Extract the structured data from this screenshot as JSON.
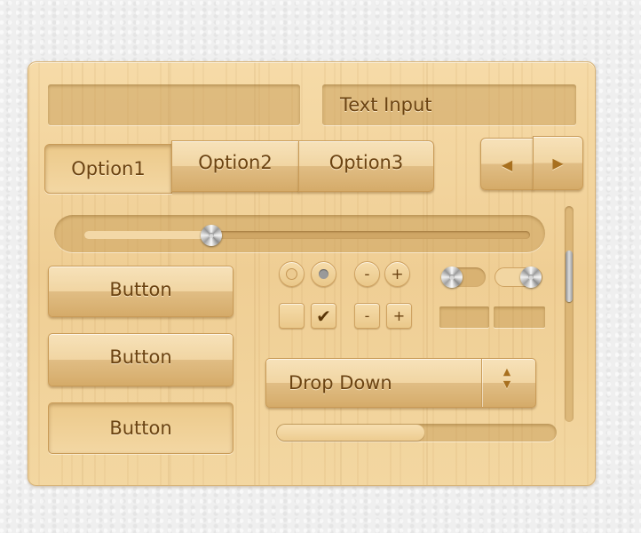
{
  "text_input": {
    "placeholder": "Text Input"
  },
  "segmented": {
    "options": [
      "Option1",
      "Option2",
      "Option3"
    ],
    "selected": "Option1"
  },
  "arrows": {
    "left_glyph": "◀",
    "right_glyph": "▶"
  },
  "slider": {
    "value_fraction": 0.32
  },
  "buttons": [
    {
      "label": "Button"
    },
    {
      "label": "Button"
    },
    {
      "label": "Button"
    }
  ],
  "steppers": {
    "minus": "-",
    "plus": "+"
  },
  "checkbox": {
    "check_glyph": "✔",
    "checked": true
  },
  "radio": {
    "selected_index": 1
  },
  "toggles": [
    {
      "state": "off"
    },
    {
      "state": "on"
    }
  ],
  "dropdown": {
    "label": "Drop Down",
    "up_glyph": "▲",
    "down_glyph": "▼"
  },
  "progress": {
    "value_fraction": 0.53
  },
  "scrollbar": {
    "thumb_fraction": 0.25
  },
  "colors": {
    "text_brown": "#6b4312",
    "wood_light": "#f6dba8",
    "wood_dark": "#d5ab69"
  }
}
